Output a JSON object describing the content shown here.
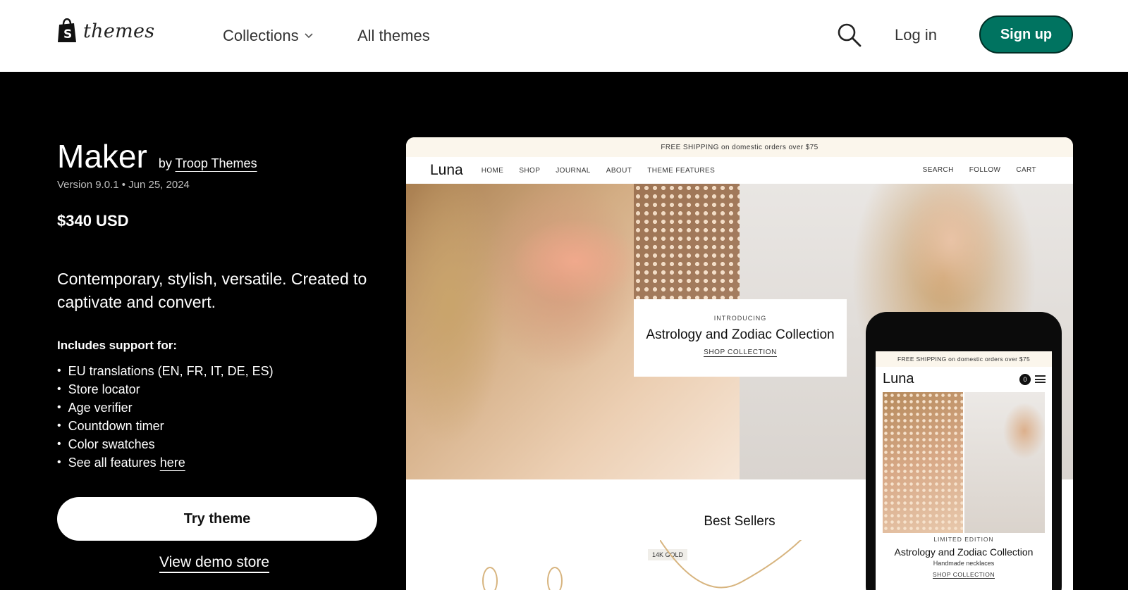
{
  "nav": {
    "logo_text": "themes",
    "collections_label": "Collections",
    "all_themes_label": "All themes",
    "login_label": "Log in",
    "signup_label": "Sign up"
  },
  "theme": {
    "name": "Maker",
    "by_prefix": "by",
    "author": "Troop Themes",
    "version": "Version 9.0.1 • Jun 25, 2024",
    "price": "$340 USD",
    "tagline": "Contemporary, stylish, versatile. Created to captivate and convert.",
    "support_heading": "Includes support for:",
    "features": [
      "EU translations (EN, FR, IT, DE, ES)",
      "Store locator",
      "Age verifier",
      "Countdown timer",
      "Color swatches"
    ],
    "see_all_prefix": "See all features",
    "see_all_link": "here",
    "try_label": "Try theme",
    "demo_label": "View demo store"
  },
  "preview": {
    "shipping_banner": "FREE SHIPPING on domestic orders over $75",
    "store_logo": "Luna",
    "store_nav": [
      "HOME",
      "SHOP",
      "JOURNAL",
      "ABOUT",
      "THEME FEATURES"
    ],
    "store_nav_right": [
      "SEARCH",
      "FOLLOW",
      "CART"
    ],
    "hero_intro": "INTRODUCING",
    "hero_title": "Astrology and Zodiac Collection",
    "hero_link": "SHOP COLLECTION",
    "best_sellers": "Best Sellers",
    "gold_tag": "14K GOLD",
    "mobile": {
      "shipping_banner": "FREE SHIPPING on domestic orders over $75",
      "logo": "Luna",
      "cart_count": "0",
      "limited": "LIMITED EDITION",
      "title": "Astrology and Zodiac Collection",
      "subtitle": "Handmade necklaces",
      "link": "SHOP COLLECTION"
    }
  },
  "colors": {
    "signup_bg": "#007360",
    "page_bg": "#000000"
  }
}
